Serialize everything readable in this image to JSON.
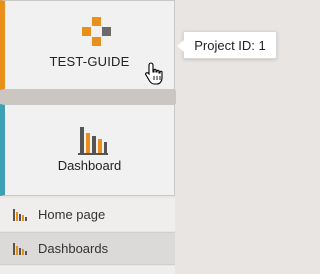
{
  "sidebar": {
    "app_tile": {
      "label": "TEST-GUIDE",
      "icon": "test-guide-logo-icon",
      "accent": "#e8901a"
    },
    "dashboard_tile": {
      "label": "Dashboard",
      "icon": "bar-chart-icon",
      "accent": "#3f9fb5"
    },
    "items": [
      {
        "label": "Home page",
        "icon": "bar-chart-icon"
      },
      {
        "label": "Dashboards",
        "icon": "bar-chart-icon"
      }
    ]
  },
  "tooltip": {
    "text": "Project ID: 1"
  },
  "colors": {
    "logo_orange": "#e8901a",
    "logo_gray": "#6b6b6b",
    "chart_dark": "#555555"
  }
}
